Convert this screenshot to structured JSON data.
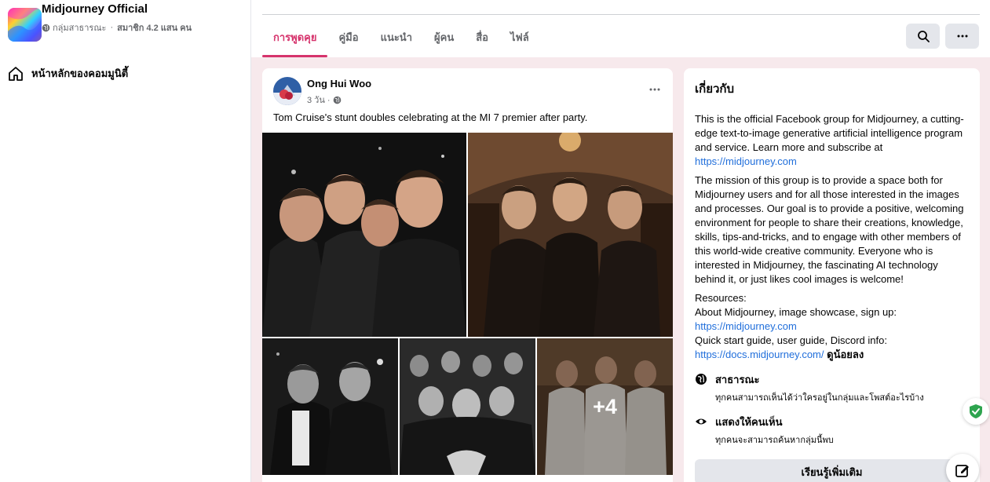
{
  "group": {
    "name": "Midjourney Official",
    "privacy": "กลุ่มสาธารณะ",
    "separator": "·",
    "members": "สมาชิก 4.2 แสน คน"
  },
  "sidebar": {
    "home_label": "หน้าหลักของคอมมูนิตี้"
  },
  "tabs": [
    {
      "label": "การพูดคุย",
      "active": true
    },
    {
      "label": "คู่มือ",
      "active": false
    },
    {
      "label": "แนะนำ",
      "active": false
    },
    {
      "label": "ผู้คน",
      "active": false
    },
    {
      "label": "สื่อ",
      "active": false
    },
    {
      "label": "ไฟล์",
      "active": false
    }
  ],
  "post": {
    "author": "Ong Hui Woo",
    "time": "3 วัน ·",
    "text": "Tom Cruise's stunt doubles celebrating at the MI 7 premier after party.",
    "more_photos": "+4"
  },
  "about": {
    "title": "เกี่ยวกับ",
    "intro": "This is the official Facebook group for Midjourney, a cutting-edge text-to-image generative artificial intelligence program and service. Learn more and subscribe at ",
    "intro_link": "https://midjourney.com",
    "mission": "The mission of this group is to provide a space both for Midjourney users and for all those interested in the images and processes. Our goal is to provide a positive, welcoming environment for people to share their creations, knowledge, skills, tips-and-tricks, and to engage with other members of this world-wide creative community. Everyone who is interested in Midjourney, the fascinating AI technology behind it, or just likes cool images is welcome!",
    "resources_label": "Resources:",
    "resources_line1": "About Midjourney, image showcase, sign up:",
    "resources_link1": "https://midjourney.com",
    "resources_line2": "Quick start guide, user guide, Discord info:",
    "resources_link2": "https://docs.midjourney.com/",
    "see_less": "ดูน้อยลง",
    "public_title": "สาธารณะ",
    "public_desc": "ทุกคนสามารถเห็นได้ว่าใครอยู่ในกลุ่มและโพสต์อะไรบ้าง",
    "visible_title": "แสดงให้คนเห็น",
    "visible_desc": "ทุกคนจะสามารถค้นหากลุ่มนี้พบ",
    "learn_more": "เรียนรู้เพิ่มเติม"
  },
  "colors": {
    "accent": "#d6336c",
    "link": "#216fdb",
    "main_bg": "#f7e9ec"
  }
}
